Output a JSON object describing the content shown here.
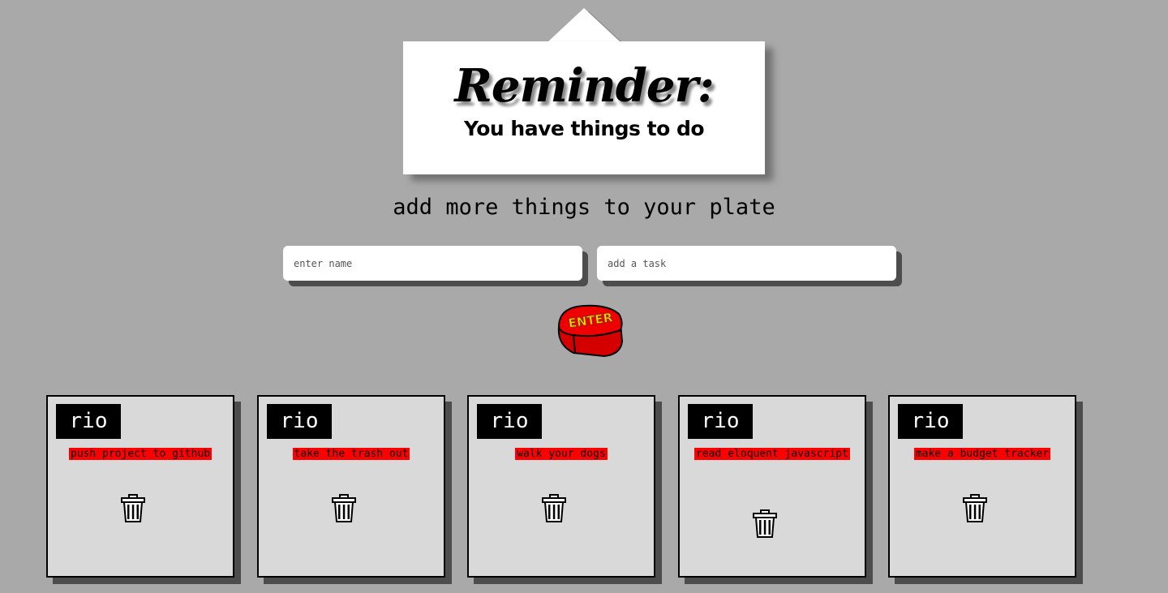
{
  "header": {
    "title": "Reminder:",
    "subtitle": "You have things to do"
  },
  "form": {
    "heading": "add more things to your plate",
    "name_placeholder": "enter name",
    "task_placeholder": "add a task",
    "enter_button_label": "ENTER"
  },
  "cards": [
    {
      "name": "rio",
      "task": "push project to github"
    },
    {
      "name": "rio",
      "task": "take the trash out"
    },
    {
      "name": "rio",
      "task": "walk your dogs"
    },
    {
      "name": "rio",
      "task": "read eloquent javascript"
    },
    {
      "name": "rio",
      "task": "make a budget tracker"
    }
  ],
  "colors": {
    "background": "#a9a9a9",
    "card": "#d9d9d9",
    "task_highlight": "#ff0000",
    "enter_button": "#e00000",
    "enter_text": "#ffd400"
  },
  "icons": {
    "delete": "trash-icon"
  }
}
